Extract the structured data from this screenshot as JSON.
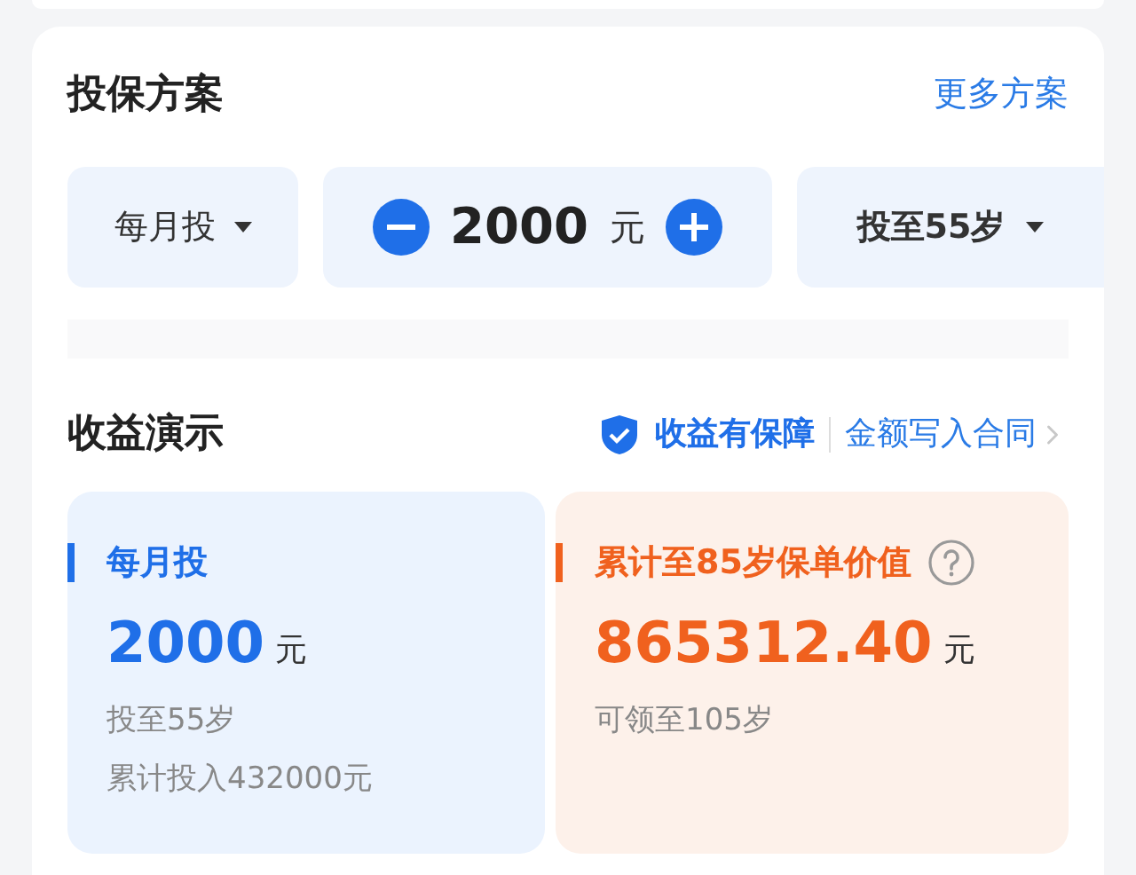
{
  "plan": {
    "title": "投保方案",
    "more_link": "更多方案",
    "frequency": "每月投",
    "amount": "2000",
    "amount_unit": "元",
    "term": "投至55岁"
  },
  "demo": {
    "title": "收益演示",
    "guarantee": "收益有保障",
    "contract": "金额写入合同",
    "cards": [
      {
        "kind": "invest",
        "label": "每月投",
        "value": "2000",
        "unit": "元",
        "lines": [
          "投至55岁",
          "累计投入432000元"
        ],
        "help": false
      },
      {
        "kind": "value",
        "label": "累计至85岁保单价值",
        "value": "865312.40",
        "unit": "元",
        "lines": [
          "可领至105岁"
        ],
        "help": true
      }
    ]
  }
}
